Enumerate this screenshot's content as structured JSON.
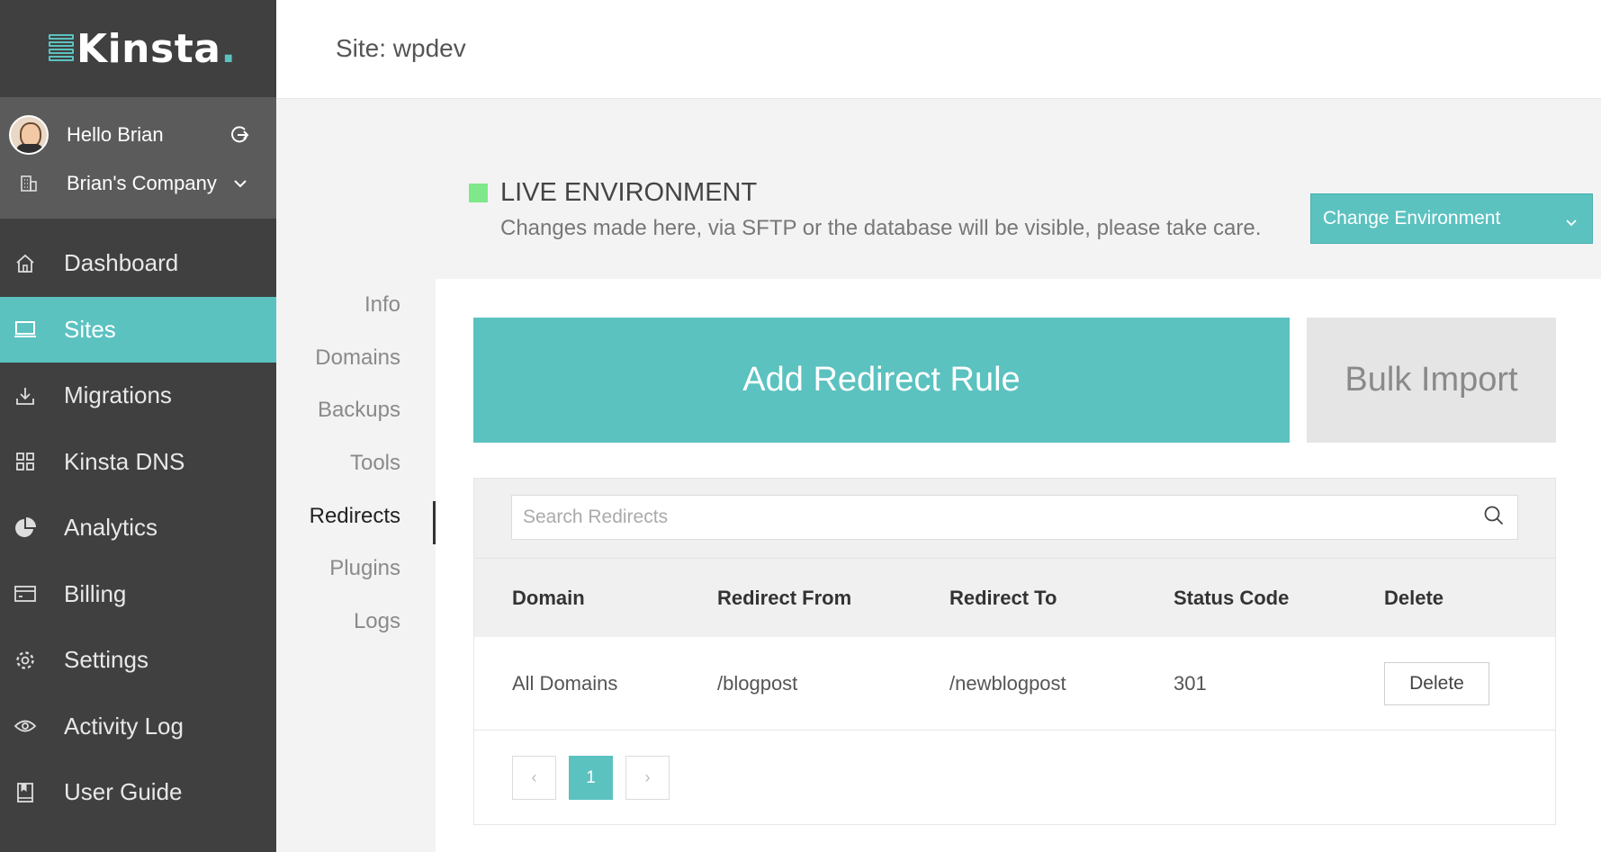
{
  "brand": {
    "name": "Kinsta",
    "accent": "#5bc2c0"
  },
  "user": {
    "greeting": "Hello Brian",
    "company": "Brian's Company"
  },
  "sidebar": {
    "items": [
      {
        "label": "Dashboard",
        "icon": "home-icon"
      },
      {
        "label": "Sites",
        "icon": "laptop-icon",
        "active": true
      },
      {
        "label": "Migrations",
        "icon": "download-icon"
      },
      {
        "label": "Kinsta DNS",
        "icon": "grid-icon"
      },
      {
        "label": "Analytics",
        "icon": "pie-chart-icon"
      },
      {
        "label": "Billing",
        "icon": "credit-card-icon"
      },
      {
        "label": "Settings",
        "icon": "gear-icon"
      },
      {
        "label": "Activity Log",
        "icon": "eye-icon"
      },
      {
        "label": "User Guide",
        "icon": "book-icon"
      }
    ]
  },
  "header": {
    "title": "Site: wpdev"
  },
  "environment": {
    "title": "LIVE ENVIRONMENT",
    "description": "Changes made here, via SFTP or the database will be visible, please take care.",
    "button_label": "Change Environment",
    "status_color": "#7fe88a"
  },
  "subnav": {
    "items": [
      "Info",
      "Domains",
      "Backups",
      "Tools",
      "Redirects",
      "Plugins",
      "Logs"
    ],
    "active": "Redirects"
  },
  "actions": {
    "add_label": "Add Redirect Rule",
    "bulk_label": "Bulk Import"
  },
  "search": {
    "placeholder": "Search Redirects",
    "value": ""
  },
  "table": {
    "headers": [
      "Domain",
      "Redirect From",
      "Redirect To",
      "Status Code",
      "Delete"
    ],
    "rows": [
      {
        "domain": "All Domains",
        "from": "/blogpost",
        "to": "/newblogpost",
        "status": "301",
        "delete_label": "Delete"
      }
    ]
  },
  "pagination": {
    "prev": "‹",
    "current": "1",
    "next": "›"
  }
}
